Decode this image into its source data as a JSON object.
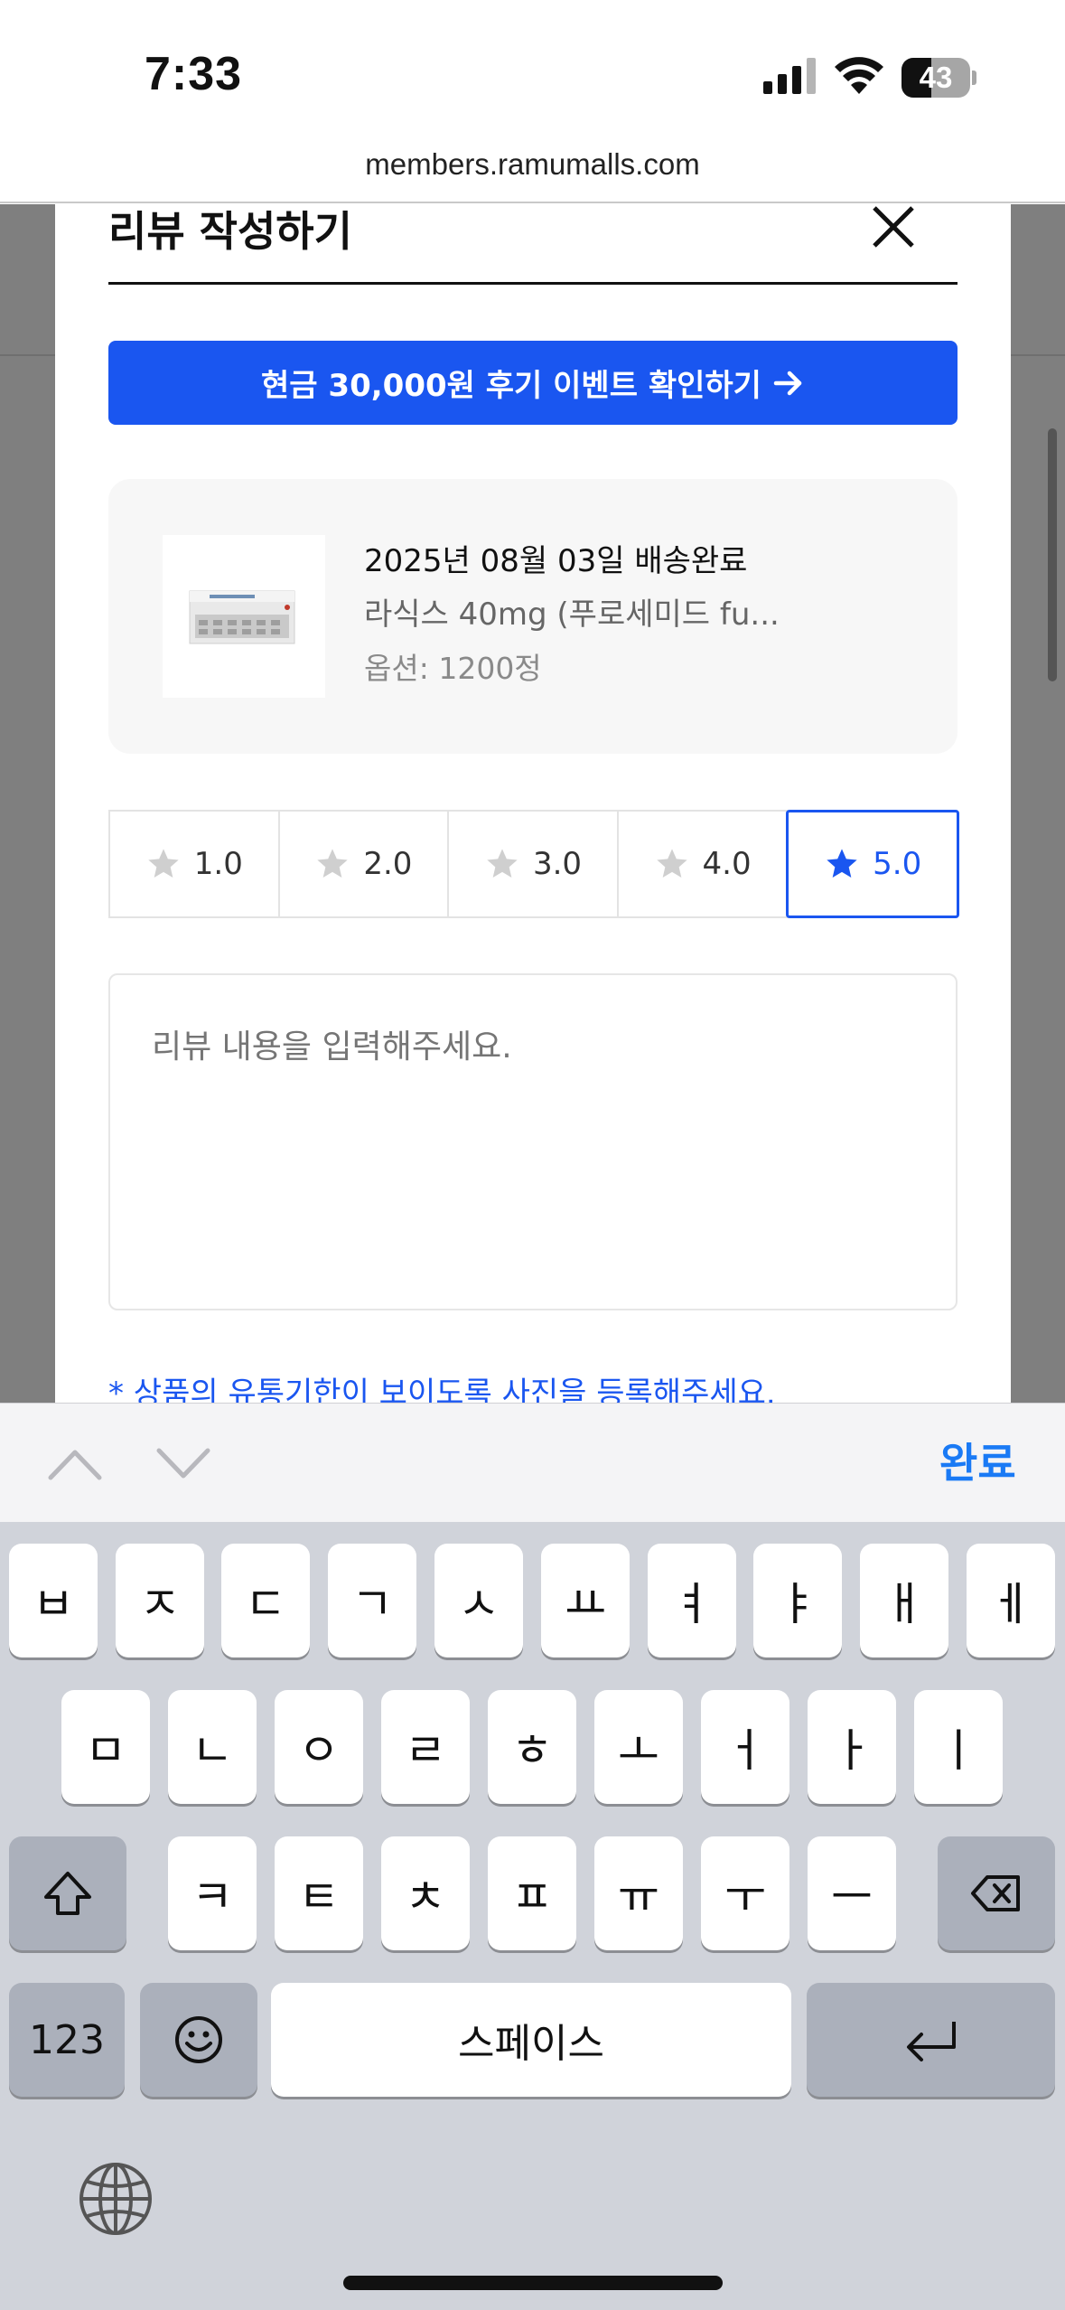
{
  "status_bar": {
    "time": "7:33",
    "battery_percent": "43",
    "battery_level": 43,
    "icons": [
      "cellular-signal-icon",
      "wifi-icon",
      "battery-icon"
    ]
  },
  "browser": {
    "url": "members.ramumalls.com"
  },
  "modal": {
    "title": "리뷰 작성하기",
    "close_icon": "close-icon",
    "event_button_label": "현금 30,000원 후기 이벤트 확인하기",
    "event_button_icon": "arrow-right-icon",
    "product": {
      "delivery": "2025년 08월 03일 배송완료",
      "name": "라식스 40mg (푸로세미드 fu...",
      "option": "옵션: 1200정"
    },
    "ratings": [
      {
        "label": "1.0",
        "selected": false
      },
      {
        "label": "2.0",
        "selected": false
      },
      {
        "label": "3.0",
        "selected": false
      },
      {
        "label": "4.0",
        "selected": false
      },
      {
        "label": "5.0",
        "selected": true
      }
    ],
    "review_placeholder": "리뷰 내용을 입력해주세요.",
    "notice": "* 상품의 유통기한이 보이도록 사진을 등록해주세요."
  },
  "keyboard_toolbar": {
    "done_label": "완료"
  },
  "keyboard": {
    "row1": [
      "ㅂ",
      "ㅈ",
      "ㄷ",
      "ㄱ",
      "ㅅ",
      "ㅛ",
      "ㅕ",
      "ㅑ",
      "ㅐ",
      "ㅔ"
    ],
    "row2": [
      "ㅁ",
      "ㄴ",
      "ㅇ",
      "ㄹ",
      "ㅎ",
      "ㅗ",
      "ㅓ",
      "ㅏ",
      "ㅣ"
    ],
    "row3": [
      "ㅋ",
      "ㅌ",
      "ㅊ",
      "ㅍ",
      "ㅠ",
      "ㅜ",
      "ㅡ"
    ],
    "numbers_label": "123",
    "space_label": "스페이스"
  },
  "colors": {
    "accent": "#1a56f0",
    "done": "#1a7af5",
    "overlay": "#7f7f7f"
  }
}
